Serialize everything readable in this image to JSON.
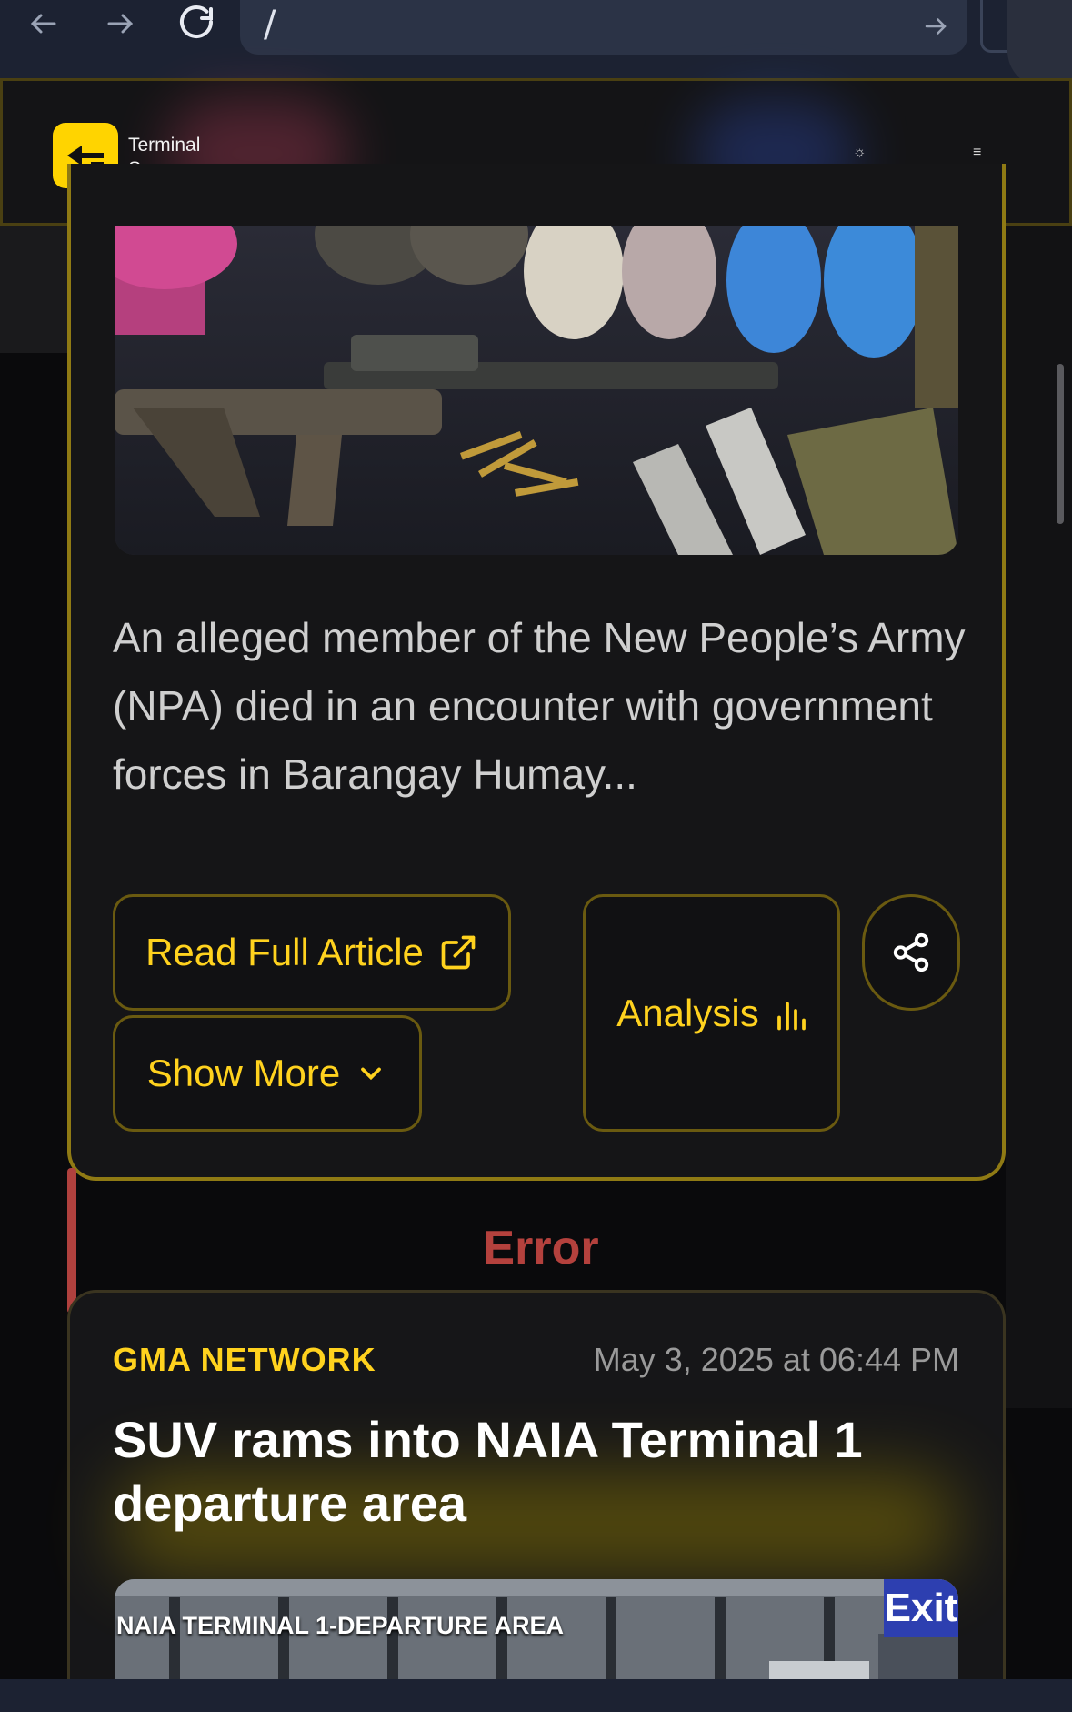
{
  "browser": {
    "url": "/",
    "back_icon": "arrow-left-icon",
    "forward_icon": "arrow-right-icon",
    "reload_icon": "reload-icon",
    "go_icon": "arrow-right-icon"
  },
  "header": {
    "brand_line1": "Terminal",
    "brand_line2": "Space",
    "theme_icon": "☼",
    "menu_icon": "≡",
    "brand_color": "#ffd400"
  },
  "article1": {
    "summary": "An alleged member of the New People’s Army (NPA) died in an encounter with government forces in Barangay Humay...",
    "read_full_label": "Read Full Article",
    "show_more_label": "Show More",
    "analysis_label": "Analysis",
    "share_icon": "share-icon",
    "accent_color": "#ffd21e"
  },
  "error_label": "Error",
  "article2": {
    "source": "GMA NETWORK",
    "date": "May 3, 2025 at 06:44 PM",
    "headline": "SUV rams into NAIA Terminal 1 departure area",
    "image_caption": "NAIA TERMINAL 1-DEPARTURE AREA",
    "image_sign": "Exit"
  }
}
